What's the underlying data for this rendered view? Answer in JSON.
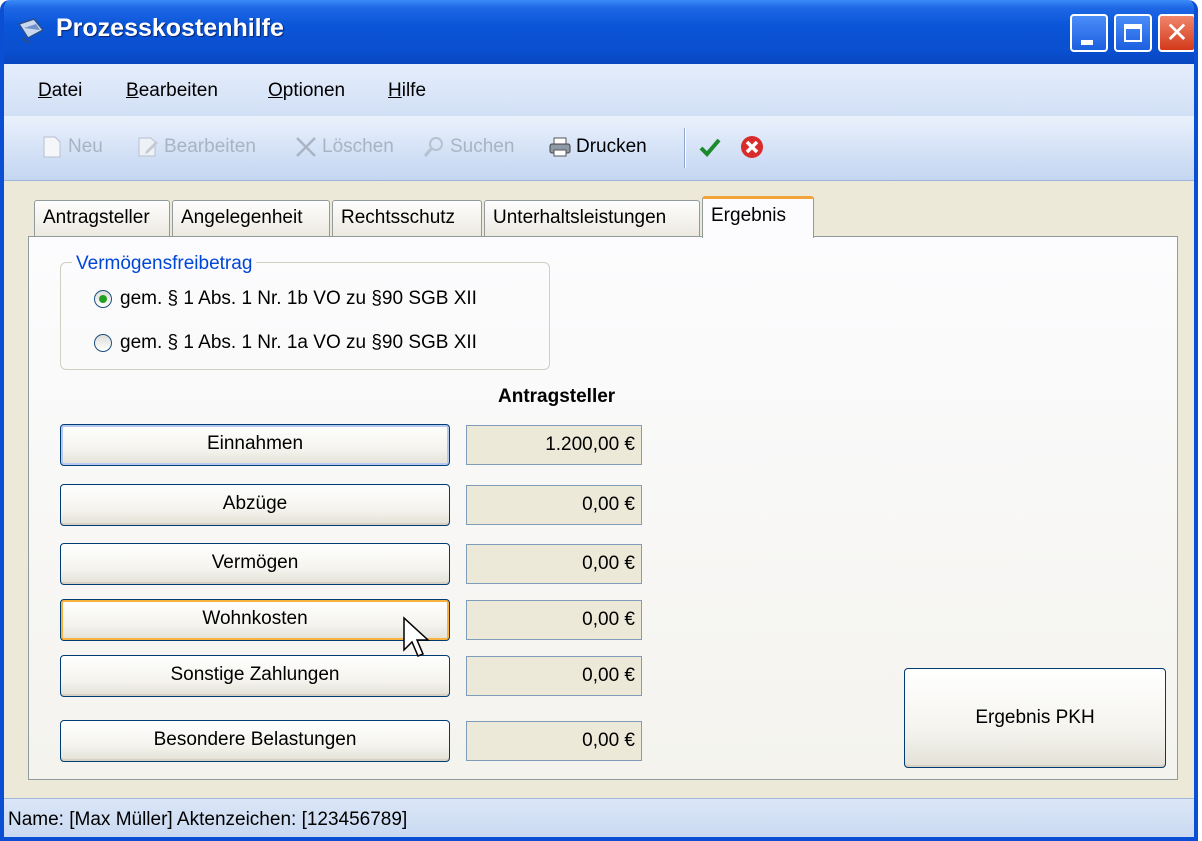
{
  "window": {
    "title": "Prozesskostenhilfe"
  },
  "menu": {
    "items": [
      {
        "prefix": "",
        "accel": "D",
        "rest": "atei"
      },
      {
        "prefix": "",
        "accel": "B",
        "rest": "earbeiten"
      },
      {
        "prefix": "",
        "accel": "O",
        "rest": "ptionen"
      },
      {
        "prefix": "",
        "accel": "H",
        "rest": "ilfe"
      }
    ]
  },
  "toolbar": {
    "new_label": "Neu",
    "edit_label": "Bearbeiten",
    "delete_label": "Löschen",
    "search_label": "Suchen",
    "print_label": "Drucken"
  },
  "tabs": [
    {
      "label": "Antragsteller"
    },
    {
      "label": "Angelegenheit"
    },
    {
      "label": "Rechtsschutz"
    },
    {
      "label": "Unterhaltsleistungen"
    },
    {
      "label": "Ergebnis"
    }
  ],
  "allowance": {
    "legend": "Vermögensfreibetrag",
    "options": [
      {
        "label": "gem. § 1 Abs. 1 Nr. 1b VO zu §90 SGB XII",
        "checked": true
      },
      {
        "label": "gem. § 1 Abs. 1 Nr. 1a VO zu §90 SGB XII",
        "checked": false
      }
    ]
  },
  "results": {
    "column_header": "Antragsteller",
    "rows": [
      {
        "label": "Einnahmen",
        "value": "1.200,00 €"
      },
      {
        "label": "Abzüge",
        "value": "0,00 €"
      },
      {
        "label": "Vermögen",
        "value": "0,00 €"
      },
      {
        "label": "Wohnkosten",
        "value": "0,00 €"
      },
      {
        "label": "Sonstige Zahlungen",
        "value": "0,00 €"
      },
      {
        "label": "Besondere Belastungen",
        "value": "0,00 €"
      }
    ],
    "result_button": "Ergebnis PKH"
  },
  "status": {
    "text": "Name: [Max Müller] Aktenzeichen: [123456789]"
  },
  "colors": {
    "titlebar": "#0a4fcf",
    "active_tab_accent": "#f2a33a",
    "legend": "#0046d5"
  }
}
